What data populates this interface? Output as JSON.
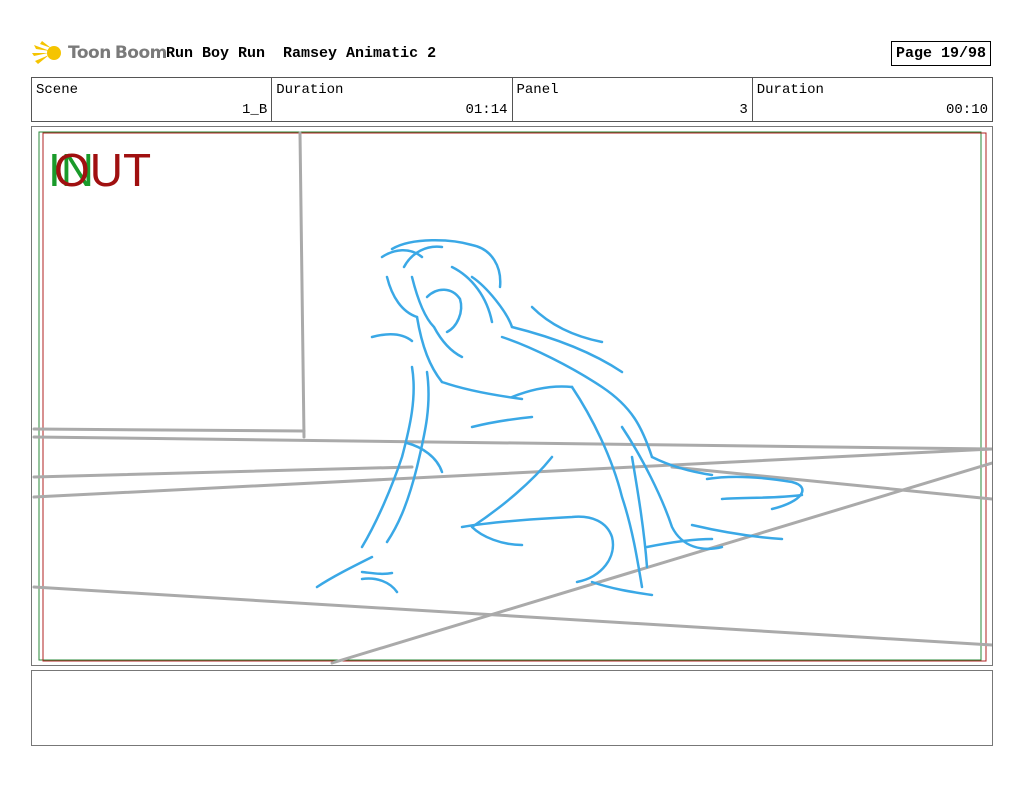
{
  "header": {
    "logo_toon": "Toon",
    "logo_boom": "Boom",
    "project": "Run Boy Run",
    "sequence": "Ramsey Animatic 2",
    "page": "Page 19/98"
  },
  "info": [
    {
      "label": "Scene",
      "value": "1_B"
    },
    {
      "label": "Duration",
      "value": "01:14"
    },
    {
      "label": "Panel",
      "value": "3"
    },
    {
      "label": "Duration",
      "value": "00:10"
    }
  ],
  "panel": {
    "in_marker": "IN",
    "out_marker": "OUT",
    "in_color": "#1a9a2a",
    "out_color": "#a01010",
    "sketch_color": "#3aa8e6",
    "layout_color": "#aaaaaa"
  },
  "notes": ""
}
